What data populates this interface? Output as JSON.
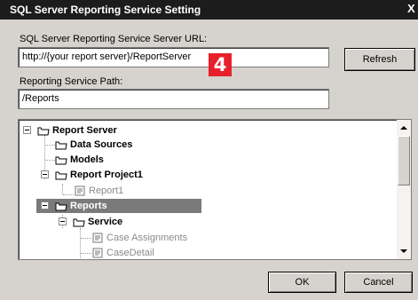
{
  "window": {
    "title": "SQL Server Reporting Service Setting",
    "close_label": "X"
  },
  "server_url": {
    "label": "SQL Server Reporting Service Server URL:",
    "value": "http://{your report server}/ReportServer"
  },
  "refresh_label": "Refresh",
  "badge": "4",
  "service_path": {
    "label": "Reporting Service Path:",
    "value": "/Reports"
  },
  "tree": {
    "root": "Report Server",
    "items": [
      {
        "label": "Data Sources"
      },
      {
        "label": "Models"
      },
      {
        "label": "Report Project1"
      },
      {
        "label": "Report1"
      },
      {
        "label": "Reports"
      },
      {
        "label": "Service"
      },
      {
        "label": "Case Assignments"
      },
      {
        "label": "CaseDetail"
      }
    ]
  },
  "buttons": {
    "ok": "OK",
    "cancel": "Cancel"
  }
}
